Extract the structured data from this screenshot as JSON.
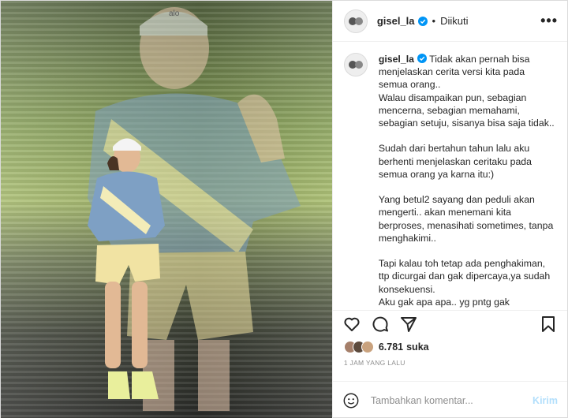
{
  "header": {
    "username": "gisel_la",
    "separator": "•",
    "follow_status": "Diikuti",
    "more_label": "•••"
  },
  "caption": {
    "username": "gisel_la",
    "text": " Tidak akan pernah bisa menjelaskan cerita versi kita pada semua orang..\nWalau disampaikan pun, sebagian mencerna, sebagian memahami, sebagian setuju, sisanya bisa saja tidak..\n\nSudah dari bertahun tahun lalu aku berhenti menjelaskan ceritaku pada semua orang ya karna itu:)\n\nYang betul2 sayang dan peduli akan mengerti.. akan menemani kita berproses, menasihati sometimes, tanpa menghakimi..\n\nTapi kalau toh tetap ada penghakiman, ttp dicurgai dan gak dipercaya,ya sudah konsekuensi.\nAku gak apa apa.. yg pntg gak"
  },
  "photo": {
    "cap_logo_text": "alo"
  },
  "likes": {
    "count": "6.781",
    "label": "suka"
  },
  "timestamp": "1 JAM YANG LALU",
  "comment": {
    "placeholder": "Tambahkan komentar...",
    "post_label": "Kirim"
  },
  "colors": {
    "verified": "#0095f6",
    "post_button": "#b2dffc"
  },
  "icons": [
    "verified-icon",
    "more-icon",
    "heart-icon",
    "comment-icon",
    "share-icon",
    "bookmark-icon",
    "emoji-icon"
  ]
}
